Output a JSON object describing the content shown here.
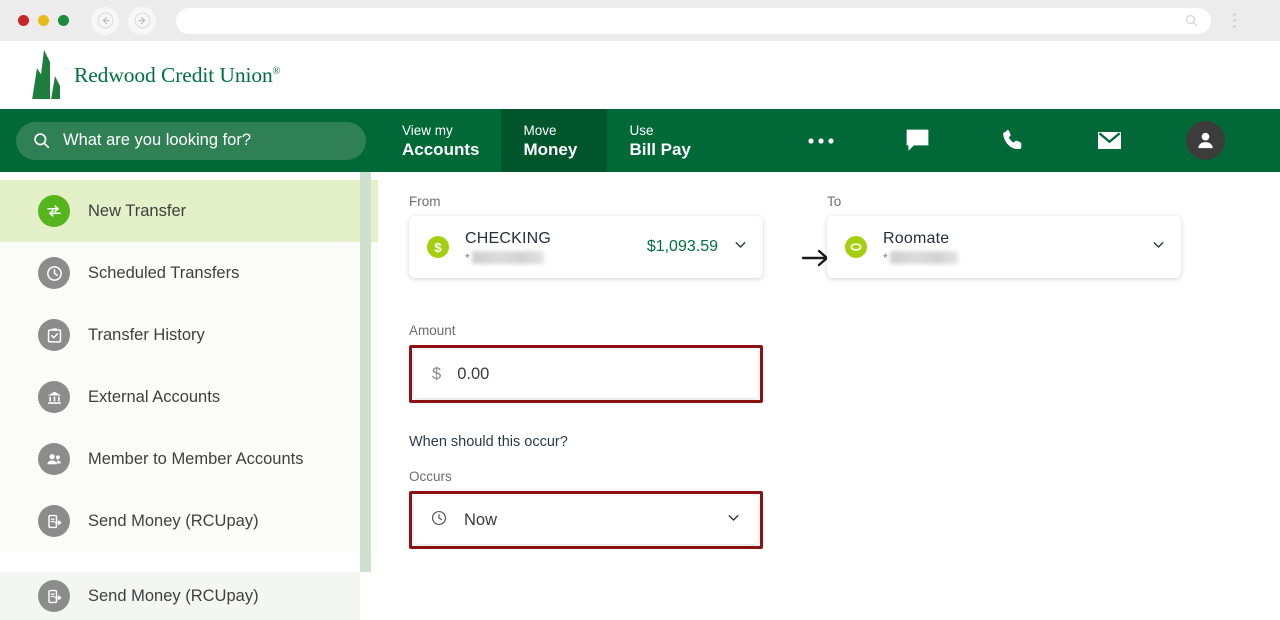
{
  "browser": {
    "back_icon": "back-arrow-icon",
    "forward_icon": "forward-arrow-icon",
    "url_value": "",
    "url_search_icon": "search-icon",
    "menu_icon": "kebab-menu-icon"
  },
  "header": {
    "logo_icon": "redwood-tree-logo-icon",
    "brand": "Redwood Credit Union",
    "brand_tm": "®"
  },
  "search": {
    "icon": "search-icon",
    "placeholder": "What are you looking for?",
    "value": ""
  },
  "nav": {
    "tabs": [
      {
        "top": "View my",
        "bottom": "Accounts",
        "active": false
      },
      {
        "top": "Move",
        "bottom": "Money",
        "active": true
      },
      {
        "top": "Use",
        "bottom": "Bill Pay",
        "active": false
      }
    ],
    "icons": [
      {
        "name": "more-ellipsis-icon",
        "label": "More"
      },
      {
        "name": "chat-bubble-icon",
        "label": "Chat"
      },
      {
        "name": "phone-icon",
        "label": "Call"
      },
      {
        "name": "envelope-icon",
        "label": "Message"
      },
      {
        "name": "user-avatar-icon",
        "label": "Account"
      }
    ]
  },
  "sidebar": {
    "items": [
      {
        "label": "New Transfer",
        "icon": "transfer-arrows-icon",
        "active": true
      },
      {
        "label": "Scheduled Transfers",
        "icon": "clock-icon",
        "active": false
      },
      {
        "label": "Transfer History",
        "icon": "clipboard-check-icon",
        "active": false
      },
      {
        "label": "External Accounts",
        "icon": "bank-icon",
        "active": false
      },
      {
        "label": "Member to Member Accounts",
        "icon": "people-icon",
        "active": false
      },
      {
        "label": "Send Money (RCUpay)",
        "icon": "send-money-icon",
        "active": false
      }
    ],
    "overflow_item": {
      "label": "Send Money (RCUpay)",
      "icon": "send-money-icon"
    },
    "scrollbar": "sidebar-scrollbar"
  },
  "transfer": {
    "from": {
      "label": "From",
      "account_icon": "dollar-circle-icon",
      "account_name": "CHECKING",
      "balance": "$1,093.59",
      "mask_prefix": "*",
      "mask_value": "",
      "chevron": "chevron-down-icon"
    },
    "direction_icon": "right-arrow-icon",
    "to": {
      "label": "To",
      "account_icon": "savings-oval-icon",
      "account_name": "Roomate",
      "mask_prefix": "*",
      "mask_value": "",
      "chevron": "chevron-down-icon"
    },
    "amount": {
      "label": "Amount",
      "currency_symbol": "$",
      "value": "0.00",
      "highlight_color": "#8f1113"
    },
    "schedule": {
      "question": "When should this occur?",
      "label": "Occurs",
      "icon": "clock-icon",
      "value": "Now",
      "chevron": "chevron-down-icon",
      "highlight_color": "#8f1113"
    }
  },
  "colors": {
    "brand_green": "#006937",
    "nav_active_green": "#00552c",
    "accent_lime": "#a6ce11",
    "sidebar_active": "#e3f0c8",
    "annotation_red": "#8f1113"
  }
}
